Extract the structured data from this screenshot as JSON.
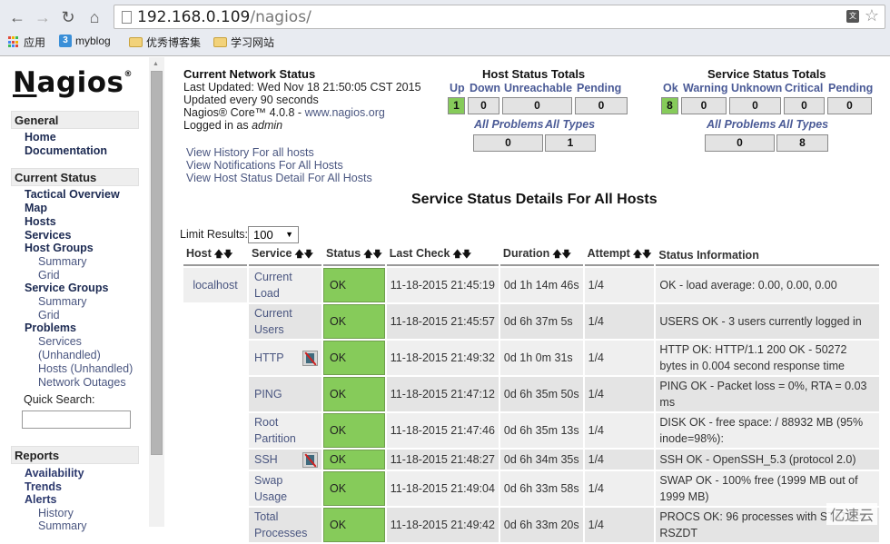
{
  "browser": {
    "url_host": "192.168.0.109",
    "url_path": "/nagios/",
    "bookmarks": [
      {
        "label": "应用",
        "icon": "apps-grid-icon"
      },
      {
        "label": "myblog",
        "icon": "blog-icon"
      },
      {
        "label": "优秀博客集",
        "icon": "folder-icon"
      },
      {
        "label": "学习网站",
        "icon": "folder-icon"
      }
    ]
  },
  "sidebar": {
    "logo": "Nagios",
    "sections": {
      "general": "General",
      "current_status": "Current Status",
      "reports": "Reports"
    },
    "general_links": [
      "Home",
      "Documentation"
    ],
    "status_links": {
      "tactical": "Tactical Overview",
      "map": "Map",
      "hosts": "Hosts",
      "services": "Services",
      "host_groups": "Host Groups",
      "hg_summary": "Summary",
      "hg_grid": "Grid",
      "service_groups": "Service Groups",
      "sg_summary": "Summary",
      "sg_grid": "Grid",
      "problems": "Problems",
      "p_services": "Services",
      "p_unhandled": "(Unhandled)",
      "p_hosts": "Hosts",
      "p_hosts_unhandled": "(Unhandled)",
      "p_outages": "Network Outages"
    },
    "quick_search_label": "Quick Search:",
    "quick_search_value": "",
    "report_links": {
      "availability": "Availability",
      "trends": "Trends",
      "alerts": "Alerts",
      "history": "History",
      "summary": "Summary"
    }
  },
  "status_info": {
    "title": "Current Network Status",
    "last_updated": "Last Updated: Wed Nov 18 21:50:05 CST 2015",
    "update_interval": "Updated every 90 seconds",
    "version_prefix": "Nagios® Core™ 4.0.8 - ",
    "version_link": "www.nagios.org",
    "logged_in_prefix": "Logged in as ",
    "user": "admin",
    "links": [
      "View History For all hosts",
      "View Notifications For All Hosts",
      "View Host Status Detail For All Hosts"
    ]
  },
  "host_totals": {
    "title": "Host Status Totals",
    "labels": [
      "Up",
      "Down",
      "Unreachable",
      "Pending"
    ],
    "values": [
      "1",
      "0",
      "0",
      "0"
    ],
    "summary_labels": [
      "All Problems",
      "All Types"
    ],
    "summary_values": [
      "0",
      "1"
    ]
  },
  "service_totals": {
    "title": "Service Status Totals",
    "labels": [
      "Ok",
      "Warning",
      "Unknown",
      "Critical",
      "Pending"
    ],
    "values": [
      "8",
      "0",
      "0",
      "0",
      "0"
    ],
    "summary_labels": [
      "All Problems",
      "All Types"
    ],
    "summary_values": [
      "0",
      "8"
    ]
  },
  "details": {
    "title": "Service Status Details For All Hosts",
    "limit_label": "Limit Results:",
    "limit_value": "100",
    "columns": [
      "Host",
      "Service",
      "Status",
      "Last Check",
      "Duration",
      "Attempt",
      "Status Information"
    ],
    "rows": [
      {
        "host": "localhost",
        "service": "Current Load",
        "status": "OK",
        "last_check": "11-18-2015 21:45:19",
        "duration": "0d 1h 14m 46s",
        "attempt": "1/4",
        "info": "OK - load average: 0.00, 0.00, 0.00",
        "flag_icon": false
      },
      {
        "host": "",
        "service": "Current Users",
        "status": "OK",
        "last_check": "11-18-2015 21:45:57",
        "duration": "0d 6h 37m 5s",
        "attempt": "1/4",
        "info": "USERS OK - 3 users currently logged in",
        "flag_icon": false
      },
      {
        "host": "",
        "service": "HTTP",
        "status": "OK",
        "last_check": "11-18-2015 21:49:32",
        "duration": "0d 1h 0m 31s",
        "attempt": "1/4",
        "info": "HTTP OK: HTTP/1.1 200 OK - 50272 bytes in 0.004 second response time",
        "flag_icon": true
      },
      {
        "host": "",
        "service": "PING",
        "status": "OK",
        "last_check": "11-18-2015 21:47:12",
        "duration": "0d 6h 35m 50s",
        "attempt": "1/4",
        "info": "PING OK - Packet loss = 0%, RTA = 0.03 ms",
        "flag_icon": false
      },
      {
        "host": "",
        "service": "Root Partition",
        "status": "OK",
        "last_check": "11-18-2015 21:47:46",
        "duration": "0d 6h 35m 13s",
        "attempt": "1/4",
        "info": "DISK OK - free space: / 88932 MB (95% inode=98%):",
        "flag_icon": false
      },
      {
        "host": "",
        "service": "SSH",
        "status": "OK",
        "last_check": "11-18-2015 21:48:27",
        "duration": "0d 6h 34m 35s",
        "attempt": "1/4",
        "info": "SSH OK - OpenSSH_5.3 (protocol 2.0)",
        "flag_icon": true
      },
      {
        "host": "",
        "service": "Swap Usage",
        "status": "OK",
        "last_check": "11-18-2015 21:49:04",
        "duration": "0d 6h 33m 58s",
        "attempt": "1/4",
        "info": "SWAP OK - 100% free (1999 MB out of 1999 MB)",
        "flag_icon": false
      },
      {
        "host": "",
        "service": "Total Processes",
        "status": "OK",
        "last_check": "11-18-2015 21:49:42",
        "duration": "0d 6h 33m 20s",
        "attempt": "1/4",
        "info": "PROCS OK: 96 processes with STATE = RSZDT",
        "flag_icon": false
      }
    ]
  },
  "watermark": "亿速云",
  "colors": {
    "ok_green": "#86cb5a",
    "link_blue": "#4a5680"
  }
}
